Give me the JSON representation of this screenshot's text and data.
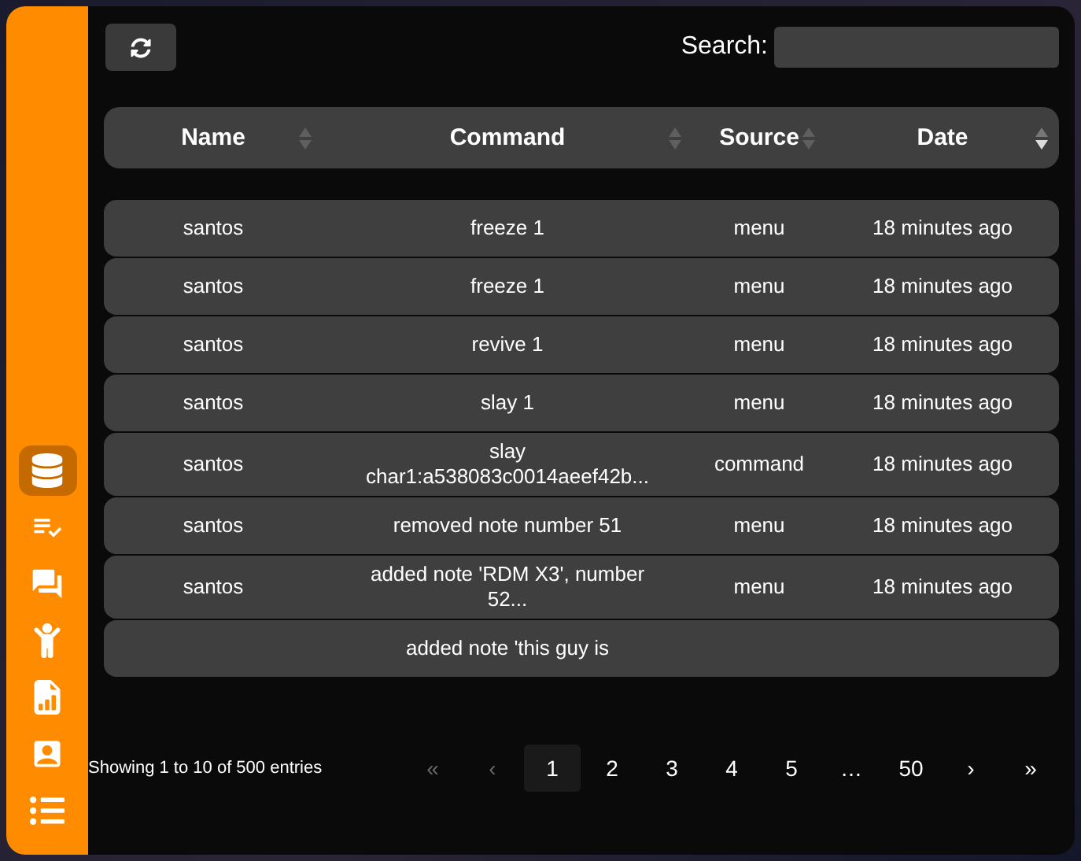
{
  "sidebar": {
    "items": [
      {
        "selected": true
      },
      {
        "selected": false
      },
      {
        "selected": false
      },
      {
        "selected": false
      },
      {
        "selected": false
      },
      {
        "selected": false
      },
      {
        "selected": false
      }
    ]
  },
  "toolbar": {
    "search_label": "Search:"
  },
  "table": {
    "columns": [
      {
        "label": "Name",
        "sorted": false
      },
      {
        "label": "Command",
        "sorted": false
      },
      {
        "label": "Source",
        "sorted": false
      },
      {
        "label": "Date",
        "sorted": true
      }
    ],
    "rows": [
      {
        "name": "santos",
        "command": "freeze 1",
        "source": "menu",
        "date": "18 minutes ago"
      },
      {
        "name": "santos",
        "command": "freeze 1",
        "source": "menu",
        "date": "18 minutes ago"
      },
      {
        "name": "santos",
        "command": "revive 1",
        "source": "menu",
        "date": "18 minutes ago"
      },
      {
        "name": "santos",
        "command": "slay 1",
        "source": "menu",
        "date": "18 minutes ago"
      },
      {
        "name": "santos",
        "command": "slay char1:a538083c0014aeef42b...",
        "source": "command",
        "date": "18 minutes ago"
      },
      {
        "name": "santos",
        "command": "removed note number 51",
        "source": "menu",
        "date": "18 minutes ago"
      },
      {
        "name": "santos",
        "command": "added note 'RDM X3', number 52...",
        "source": "menu",
        "date": "18 minutes ago"
      },
      {
        "command": "added note 'this guy is"
      }
    ]
  },
  "footer": {
    "info": "Showing 1 to 10 of 500 entries",
    "pages": [
      {
        "label": "«",
        "selected": false,
        "disabled": true
      },
      {
        "label": "‹",
        "selected": false,
        "disabled": true
      },
      {
        "label": "1",
        "selected": true,
        "disabled": false
      },
      {
        "label": "2",
        "selected": false,
        "disabled": false
      },
      {
        "label": "3",
        "selected": false,
        "disabled": false
      },
      {
        "label": "4",
        "selected": false,
        "disabled": false
      },
      {
        "label": "5",
        "selected": false,
        "disabled": false
      },
      {
        "label": "…",
        "selected": false,
        "disabled": false
      },
      {
        "label": "50",
        "selected": false,
        "disabled": false
      },
      {
        "label": "›",
        "selected": false,
        "disabled": false
      },
      {
        "label": "»",
        "selected": false,
        "disabled": false
      }
    ]
  }
}
